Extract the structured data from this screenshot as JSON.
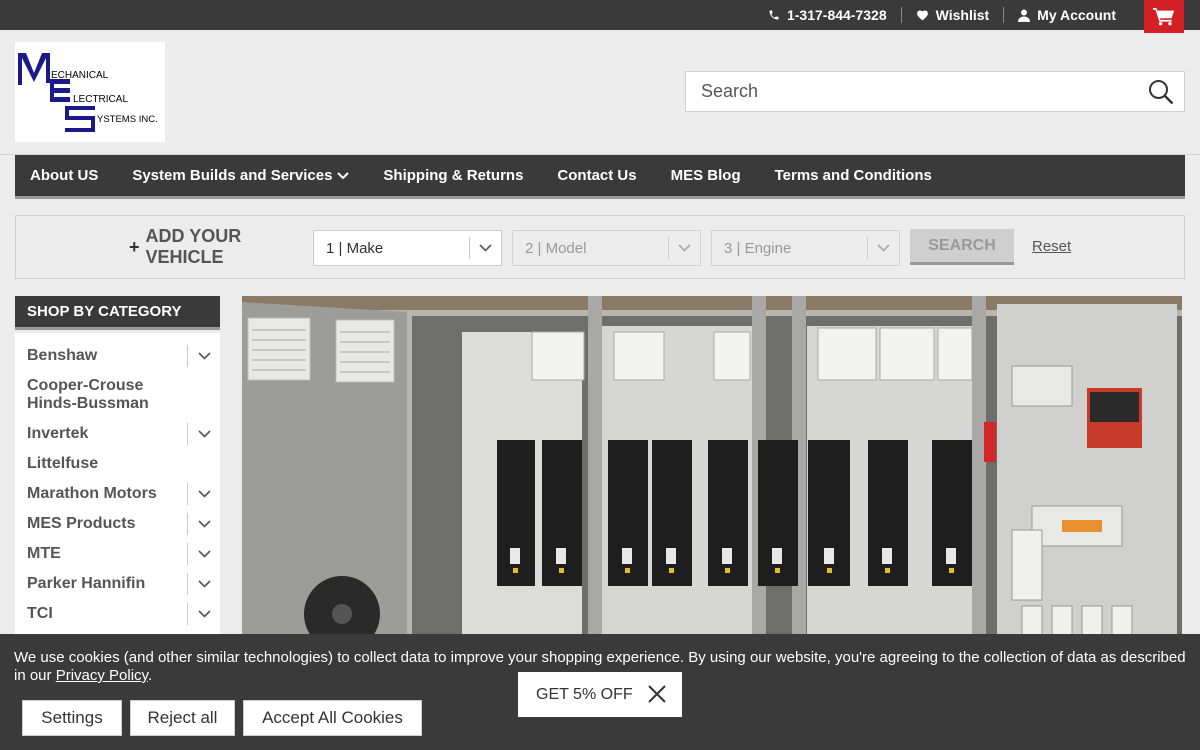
{
  "topbar": {
    "phone": "1-317-844-7328",
    "wishlist": "Wishlist",
    "account": "My Account"
  },
  "logo": {
    "line1": "ECHANICAL",
    "line2": "LECTRICAL",
    "line3": "YSTEMS INC.",
    "brand_color": "#1a1a8c"
  },
  "search": {
    "placeholder": "Search"
  },
  "nav": {
    "items": [
      "About US",
      "System Builds and Services",
      "Shipping & Returns",
      "Contact Us",
      "MES Blog",
      "Terms and Conditions"
    ]
  },
  "finder": {
    "add_line1": "ADD YOUR",
    "add_line2": "VEHICLE",
    "make": "1 | Make",
    "model": "2 | Model",
    "engine": "3 | Engine",
    "search": "SEARCH",
    "reset": "Reset"
  },
  "sidebar": {
    "title": "SHOP BY CATEGORY",
    "items": [
      {
        "label": "Benshaw",
        "expandable": true
      },
      {
        "label": "Cooper-Crouse Hinds-Bussman",
        "expandable": false
      },
      {
        "label": "Invertek",
        "expandable": true
      },
      {
        "label": "Littelfuse",
        "expandable": false
      },
      {
        "label": "Marathon Motors",
        "expandable": true
      },
      {
        "label": "MES Products",
        "expandable": true
      },
      {
        "label": "MTE",
        "expandable": true
      },
      {
        "label": "Parker Hannifin",
        "expandable": true
      },
      {
        "label": "TCI",
        "expandable": true
      }
    ]
  },
  "cookie": {
    "message": "We use cookies (and other similar technologies) to collect data to improve your shopping experience. By using our website, you're agreeing to the collection of data as described in our ",
    "policy_link": "Privacy Policy",
    "period": ".",
    "settings": "Settings",
    "reject": "Reject all",
    "accept": "Accept All Cookies"
  },
  "promo": {
    "label": "GET 5% OFF"
  },
  "colors": {
    "dark": "#3a3a3a",
    "cart_red": "#d32027",
    "background": "#ececec"
  }
}
